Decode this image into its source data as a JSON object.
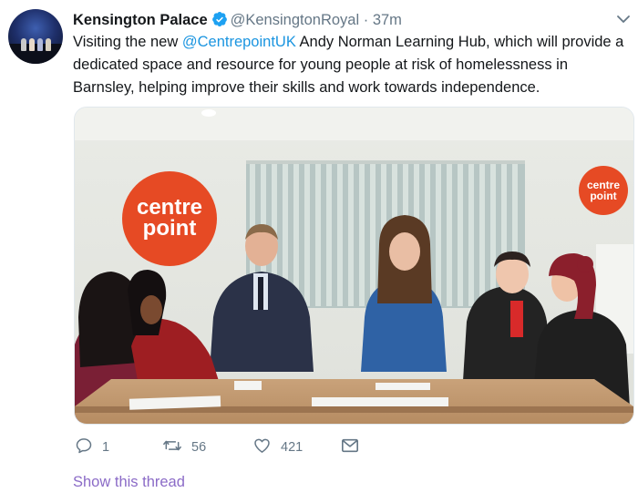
{
  "tweet": {
    "author_name": "Kensington Palace",
    "handle": "@KensingtonRoyal",
    "separator": "·",
    "time": "37m",
    "text_pre": "Visiting the new ",
    "mention": "@CentrepointUK",
    "text_post": " Andy Norman Learning Hub, which will provide a dedicated space and resource for young people at risk of homelessness in Barnsley, helping improve their skills and work towards independence.",
    "media": {
      "sign_left_line1": "centre",
      "sign_left_line2": "point",
      "sign_right_line1": "centre",
      "sign_right_line2": "point",
      "brand_color": "#e64a24"
    },
    "actions": {
      "reply_count": "1",
      "retweet_count": "56",
      "like_count": "421"
    },
    "show_thread": "Show this thread"
  },
  "icons": {
    "verified": "verified-badge-icon",
    "caret": "chevron-down-icon",
    "reply": "reply-icon",
    "retweet": "retweet-icon",
    "like": "heart-icon",
    "message": "envelope-icon"
  },
  "colors": {
    "text": "#14171a",
    "secondary": "#657786",
    "link": "#1b95e0",
    "thread_link": "#8b6bc7",
    "verified": "#1da1f2"
  }
}
